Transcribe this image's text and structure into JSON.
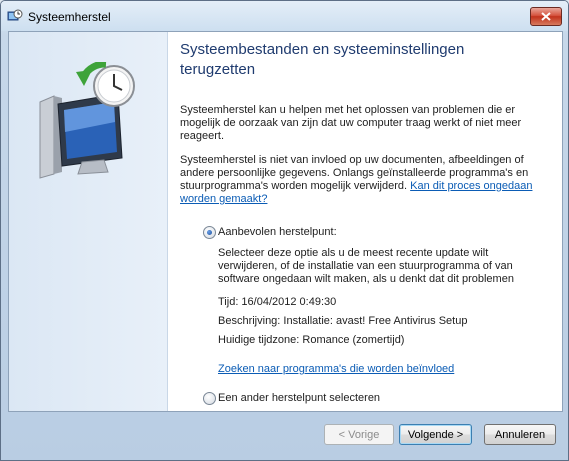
{
  "window": {
    "title": "Systeemherstel",
    "icons": {
      "app": "system-restore-icon",
      "close": "close-icon",
      "illustration": "computer-restore-clock-icon"
    }
  },
  "main": {
    "heading": "Systeembestanden en systeeminstellingen terugzetten",
    "para1": "Systeemherstel kan u helpen met het oplossen van problemen die er mogelijk de oorzaak van zijn dat uw computer traag werkt of niet meer reageert.",
    "para2": "Systeemherstel is niet van invloed op uw documenten, afbeeldingen of andere persoonlijke gegevens. Onlangs geïnstalleerde programma's en stuurprogramma's worden mogelijk verwijderd.",
    "para2_link": "Kan dit proces ongedaan worden gemaakt?"
  },
  "options": {
    "recommended": {
      "label": "Aanbevolen herstelpunt:",
      "checked": true,
      "description": "Selecteer deze optie als u de meest recente update wilt verwijderen, of de installatie van een stuurprogramma of van software ongedaan wilt maken, als u denkt dat dit problemen",
      "time": "Tijd: 16/04/2012 0:49:30",
      "description_line": "Beschrijving: Installatie: avast! Free Antivirus Setup",
      "timezone": "Huidige tijdzone: Romance (zomertijd)",
      "link": "Zoeken naar programma's die worden beïnvloed"
    },
    "other": {
      "label": "Een ander herstelpunt selecteren",
      "checked": false
    }
  },
  "buttons": {
    "back": "< Vorige",
    "next": "Volgende >",
    "cancel": "Annuleren"
  },
  "colors": {
    "heading": "#1f3b6f",
    "link": "#0b5cb5",
    "close_button": "#c2311c"
  }
}
